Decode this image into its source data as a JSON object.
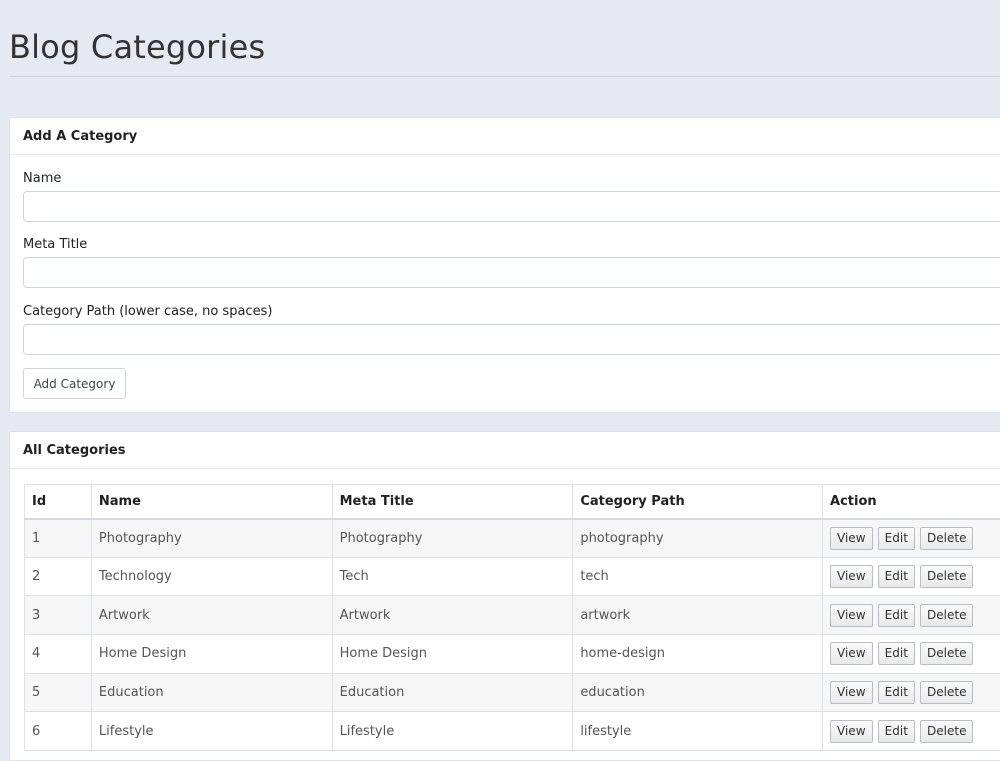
{
  "page": {
    "title": "Blog Categories"
  },
  "add_form": {
    "heading": "Add A Category",
    "fields": {
      "name": {
        "label": "Name",
        "value": "",
        "placeholder": ""
      },
      "meta_title": {
        "label": "Meta Title",
        "value": "",
        "placeholder": ""
      },
      "path": {
        "label": "Category Path (lower case, no spaces)",
        "value": "",
        "placeholder": ""
      }
    },
    "submit_label": "Add Category"
  },
  "list": {
    "heading": "All Categories",
    "columns": [
      "Id",
      "Name",
      "Meta Title",
      "Category Path",
      "Action"
    ],
    "actions": {
      "view": "View",
      "edit": "Edit",
      "delete": "Delete"
    },
    "rows": [
      {
        "id": "1",
        "name": "Photography",
        "meta_title": "Photography",
        "path": "photography"
      },
      {
        "id": "2",
        "name": "Technology",
        "meta_title": "Tech",
        "path": "tech"
      },
      {
        "id": "3",
        "name": "Artwork",
        "meta_title": "Artwork",
        "path": "artwork"
      },
      {
        "id": "4",
        "name": "Home Design",
        "meta_title": "Home Design",
        "path": "home-design"
      },
      {
        "id": "5",
        "name": "Education",
        "meta_title": "Education",
        "path": "education"
      },
      {
        "id": "6",
        "name": "Lifestyle",
        "meta_title": "Lifestyle",
        "path": "lifestyle"
      }
    ]
  }
}
